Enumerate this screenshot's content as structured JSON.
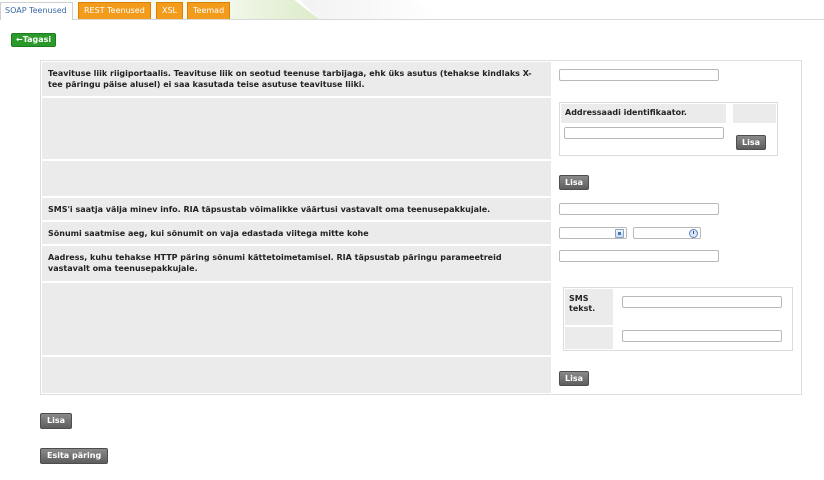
{
  "tabs": [
    {
      "label": "SOAP Teenused",
      "active": true
    },
    {
      "label": "REST Teenused",
      "active": false
    },
    {
      "label": "XSL",
      "active": false
    },
    {
      "label": "Teemad",
      "active": false
    }
  ],
  "back_button": "←Tagasi",
  "form": {
    "row1_label": "Teavituse liik riigiportaalis. Teavituse liik on seotud teenuse tarbijaga, ehk üks asutus (tehakse kindlaks X-tee päringu päise alusel) ei saa kasutada teise asutuse teavituse liiki.",
    "row1_value": "",
    "addressee_header": "Addressaadi identifikaator.",
    "addressee_value": "",
    "add_label": "Lisa",
    "row4_label": "SMS'i saatja välja minev info. RIA täpsustab võimalikke väärtusi vastavalt oma teenusepakkujale.",
    "row4_value": "",
    "row5_label": "Sõnumi saatmise aeg, kui sõnumit on vaja edastada viitega mitte kohe",
    "date_value": "",
    "time_value": "",
    "row6_label": "Aadress, kuhu tehakse HTTP päring sõnumi kättetoimetamisel. RIA täpsustab päringu parameetreid vastavalt oma teenusepakkujale.",
    "row6_value": "",
    "sms_label": "SMS tekst.",
    "sms_value_1": "",
    "sms_value_2": ""
  },
  "bottom": {
    "add_label": "Lisa",
    "submit_label": "Esita päring"
  },
  "colors": {
    "back_button": "#2a9a2a",
    "tab_orange": "#f39b1b",
    "active_tab_text": "#3a6aa8"
  }
}
